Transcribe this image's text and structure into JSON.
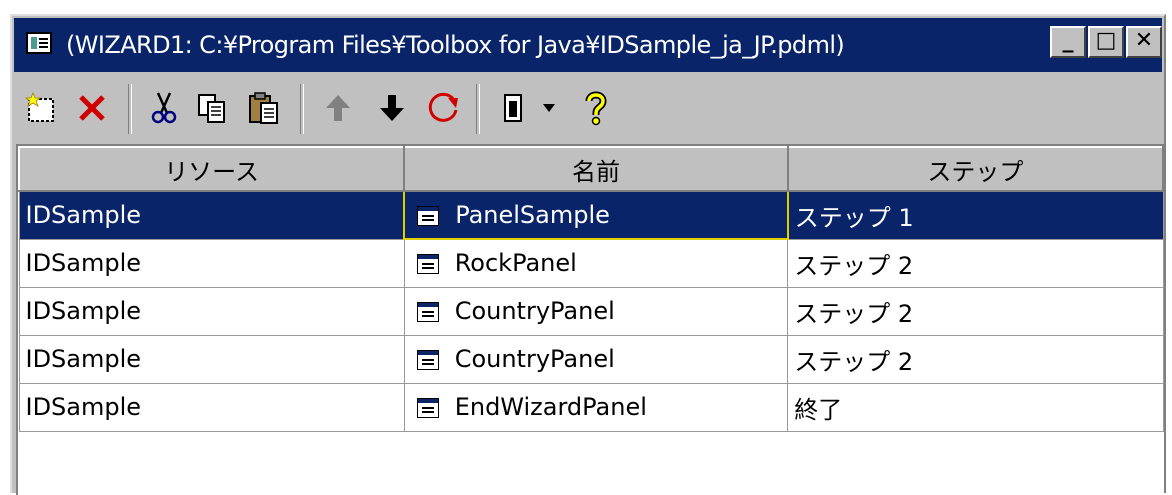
{
  "window": {
    "title": "(WIZARD1: C:¥Program Files¥Toolbox for Java¥IDSample_ja_JP.pdml)",
    "controls": {
      "minimize": "_",
      "maximize": "□",
      "close": "✕"
    }
  },
  "toolbar": {
    "items": [
      "new-icon",
      "delete-icon",
      "cut-icon",
      "copy-icon",
      "paste-icon",
      "move-up-icon",
      "move-down-icon",
      "refresh-icon",
      "properties-icon",
      "dropdown-arrow-icon",
      "help-icon"
    ]
  },
  "table": {
    "columns": [
      "リソース",
      "名前",
      "ステップ"
    ],
    "rows": [
      {
        "resource": "IDSample",
        "name": "PanelSample",
        "step": "ステップ 1",
        "selected": true
      },
      {
        "resource": "IDSample",
        "name": "RockPanel",
        "step": "ステップ 2"
      },
      {
        "resource": "IDSample",
        "name": "CountryPanel",
        "step": "ステップ 2"
      },
      {
        "resource": "IDSample",
        "name": "CountryPanel",
        "step": "ステップ 2"
      },
      {
        "resource": "IDSample",
        "name": "EndWizardPanel",
        "step": "終了"
      }
    ]
  },
  "colors": {
    "titlebar": "#0a246a",
    "selection": "#0a246a",
    "face": "#c0c0c0"
  }
}
